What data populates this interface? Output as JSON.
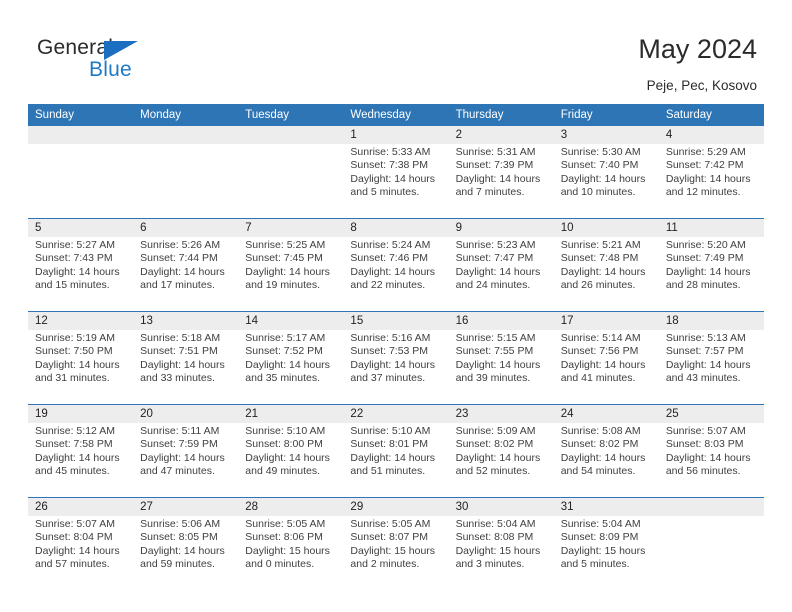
{
  "brand": {
    "name_top": "General",
    "name_bottom": "Blue",
    "triangle_color": "#1c6fc0",
    "blue_text_color": "#1f7ac4"
  },
  "header": {
    "title": "May 2024",
    "subtitle": "Peje, Pec, Kosovo"
  },
  "theme": {
    "header_blue": "#2e75b6",
    "date_band_gray": "#ededed",
    "text_color": "#404040"
  },
  "calendar": {
    "weekday_headers": [
      "Sunday",
      "Monday",
      "Tuesday",
      "Wednesday",
      "Thursday",
      "Friday",
      "Saturday"
    ],
    "weeks": [
      {
        "days": [
          {
            "num": "",
            "lines": []
          },
          {
            "num": "",
            "lines": []
          },
          {
            "num": "",
            "lines": []
          },
          {
            "num": "1",
            "lines": [
              "Sunrise: 5:33 AM",
              "Sunset: 7:38 PM",
              "Daylight: 14 hours",
              "and 5 minutes."
            ]
          },
          {
            "num": "2",
            "lines": [
              "Sunrise: 5:31 AM",
              "Sunset: 7:39 PM",
              "Daylight: 14 hours",
              "and 7 minutes."
            ]
          },
          {
            "num": "3",
            "lines": [
              "Sunrise: 5:30 AM",
              "Sunset: 7:40 PM",
              "Daylight: 14 hours",
              "and 10 minutes."
            ]
          },
          {
            "num": "4",
            "lines": [
              "Sunrise: 5:29 AM",
              "Sunset: 7:42 PM",
              "Daylight: 14 hours",
              "and 12 minutes."
            ]
          }
        ]
      },
      {
        "days": [
          {
            "num": "5",
            "lines": [
              "Sunrise: 5:27 AM",
              "Sunset: 7:43 PM",
              "Daylight: 14 hours",
              "and 15 minutes."
            ]
          },
          {
            "num": "6",
            "lines": [
              "Sunrise: 5:26 AM",
              "Sunset: 7:44 PM",
              "Daylight: 14 hours",
              "and 17 minutes."
            ]
          },
          {
            "num": "7",
            "lines": [
              "Sunrise: 5:25 AM",
              "Sunset: 7:45 PM",
              "Daylight: 14 hours",
              "and 19 minutes."
            ]
          },
          {
            "num": "8",
            "lines": [
              "Sunrise: 5:24 AM",
              "Sunset: 7:46 PM",
              "Daylight: 14 hours",
              "and 22 minutes."
            ]
          },
          {
            "num": "9",
            "lines": [
              "Sunrise: 5:23 AM",
              "Sunset: 7:47 PM",
              "Daylight: 14 hours",
              "and 24 minutes."
            ]
          },
          {
            "num": "10",
            "lines": [
              "Sunrise: 5:21 AM",
              "Sunset: 7:48 PM",
              "Daylight: 14 hours",
              "and 26 minutes."
            ]
          },
          {
            "num": "11",
            "lines": [
              "Sunrise: 5:20 AM",
              "Sunset: 7:49 PM",
              "Daylight: 14 hours",
              "and 28 minutes."
            ]
          }
        ]
      },
      {
        "days": [
          {
            "num": "12",
            "lines": [
              "Sunrise: 5:19 AM",
              "Sunset: 7:50 PM",
              "Daylight: 14 hours",
              "and 31 minutes."
            ]
          },
          {
            "num": "13",
            "lines": [
              "Sunrise: 5:18 AM",
              "Sunset: 7:51 PM",
              "Daylight: 14 hours",
              "and 33 minutes."
            ]
          },
          {
            "num": "14",
            "lines": [
              "Sunrise: 5:17 AM",
              "Sunset: 7:52 PM",
              "Daylight: 14 hours",
              "and 35 minutes."
            ]
          },
          {
            "num": "15",
            "lines": [
              "Sunrise: 5:16 AM",
              "Sunset: 7:53 PM",
              "Daylight: 14 hours",
              "and 37 minutes."
            ]
          },
          {
            "num": "16",
            "lines": [
              "Sunrise: 5:15 AM",
              "Sunset: 7:55 PM",
              "Daylight: 14 hours",
              "and 39 minutes."
            ]
          },
          {
            "num": "17",
            "lines": [
              "Sunrise: 5:14 AM",
              "Sunset: 7:56 PM",
              "Daylight: 14 hours",
              "and 41 minutes."
            ]
          },
          {
            "num": "18",
            "lines": [
              "Sunrise: 5:13 AM",
              "Sunset: 7:57 PM",
              "Daylight: 14 hours",
              "and 43 minutes."
            ]
          }
        ]
      },
      {
        "days": [
          {
            "num": "19",
            "lines": [
              "Sunrise: 5:12 AM",
              "Sunset: 7:58 PM",
              "Daylight: 14 hours",
              "and 45 minutes."
            ]
          },
          {
            "num": "20",
            "lines": [
              "Sunrise: 5:11 AM",
              "Sunset: 7:59 PM",
              "Daylight: 14 hours",
              "and 47 minutes."
            ]
          },
          {
            "num": "21",
            "lines": [
              "Sunrise: 5:10 AM",
              "Sunset: 8:00 PM",
              "Daylight: 14 hours",
              "and 49 minutes."
            ]
          },
          {
            "num": "22",
            "lines": [
              "Sunrise: 5:10 AM",
              "Sunset: 8:01 PM",
              "Daylight: 14 hours",
              "and 51 minutes."
            ]
          },
          {
            "num": "23",
            "lines": [
              "Sunrise: 5:09 AM",
              "Sunset: 8:02 PM",
              "Daylight: 14 hours",
              "and 52 minutes."
            ]
          },
          {
            "num": "24",
            "lines": [
              "Sunrise: 5:08 AM",
              "Sunset: 8:02 PM",
              "Daylight: 14 hours",
              "and 54 minutes."
            ]
          },
          {
            "num": "25",
            "lines": [
              "Sunrise: 5:07 AM",
              "Sunset: 8:03 PM",
              "Daylight: 14 hours",
              "and 56 minutes."
            ]
          }
        ]
      },
      {
        "days": [
          {
            "num": "26",
            "lines": [
              "Sunrise: 5:07 AM",
              "Sunset: 8:04 PM",
              "Daylight: 14 hours",
              "and 57 minutes."
            ]
          },
          {
            "num": "27",
            "lines": [
              "Sunrise: 5:06 AM",
              "Sunset: 8:05 PM",
              "Daylight: 14 hours",
              "and 59 minutes."
            ]
          },
          {
            "num": "28",
            "lines": [
              "Sunrise: 5:05 AM",
              "Sunset: 8:06 PM",
              "Daylight: 15 hours",
              "and 0 minutes."
            ]
          },
          {
            "num": "29",
            "lines": [
              "Sunrise: 5:05 AM",
              "Sunset: 8:07 PM",
              "Daylight: 15 hours",
              "and 2 minutes."
            ]
          },
          {
            "num": "30",
            "lines": [
              "Sunrise: 5:04 AM",
              "Sunset: 8:08 PM",
              "Daylight: 15 hours",
              "and 3 minutes."
            ]
          },
          {
            "num": "31",
            "lines": [
              "Sunrise: 5:04 AM",
              "Sunset: 8:09 PM",
              "Daylight: 15 hours",
              "and 5 minutes."
            ]
          },
          {
            "num": "",
            "lines": []
          }
        ]
      }
    ]
  }
}
